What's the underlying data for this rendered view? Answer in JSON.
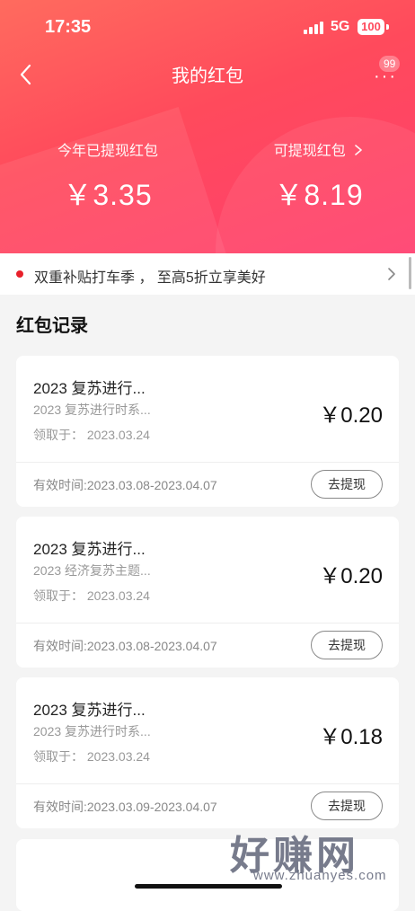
{
  "status_bar": {
    "time": "17:35",
    "network": "5G",
    "battery": "100"
  },
  "header": {
    "title": "我的红包",
    "more_badge": "99",
    "withdrawn_label": "今年已提现红包",
    "withdrawn_amount": "￥3.35",
    "available_label": "可提现红包",
    "available_amount": "￥8.19"
  },
  "banner": {
    "text": "双重补贴打车季 ， 至高5折立享美好"
  },
  "section_title": "红包记录",
  "records": [
    {
      "name": "2023 复苏进行...",
      "desc": "2023 复苏进行时系...",
      "received": "领取于：  2023.03.24",
      "amount": "￥0.20",
      "valid": "有效时间:2023.03.08-2023.04.07",
      "action": "去提现"
    },
    {
      "name": "2023 复苏进行...",
      "desc": "2023 经济复苏主题...",
      "received": "领取于：  2023.03.24",
      "amount": "￥0.20",
      "valid": "有效时间:2023.03.08-2023.04.07",
      "action": "去提现"
    },
    {
      "name": "2023 复苏进行...",
      "desc": "2023 复苏进行时系...",
      "received": "领取于：  2023.03.24",
      "amount": "￥0.18",
      "valid": "有效时间:2023.03.09-2023.04.07",
      "action": "去提现"
    }
  ],
  "watermark": {
    "text": "好赚网",
    "url": "www.zhuanyes.com"
  },
  "colors": {
    "header_start": "#ff6b5e",
    "header_end": "#ff3f6e",
    "banner_dot": "#e8202a"
  }
}
